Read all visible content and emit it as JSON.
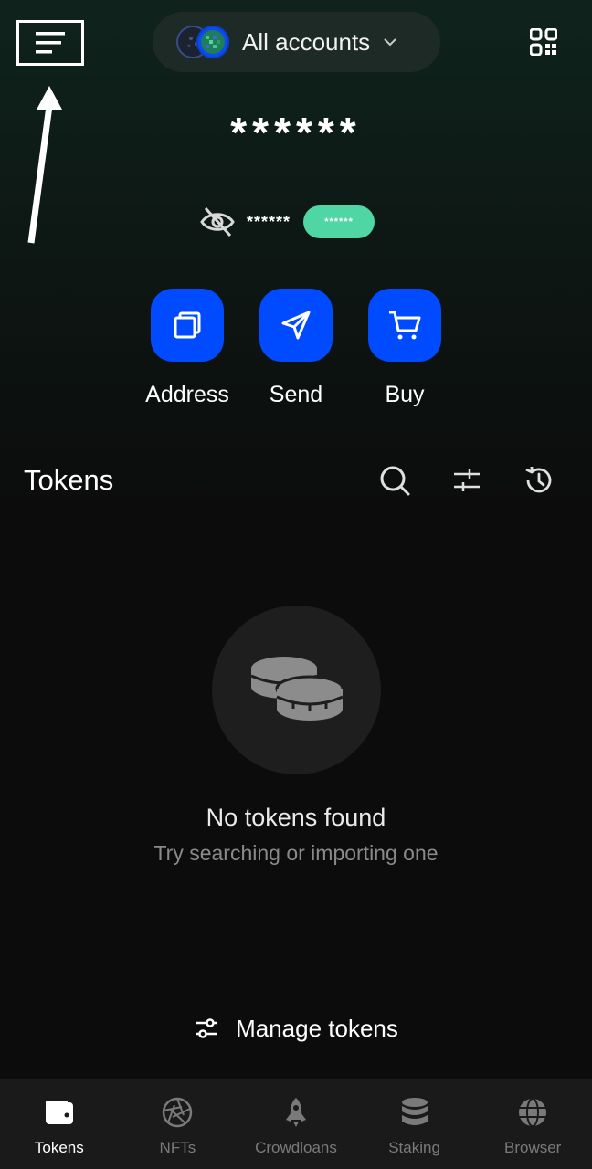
{
  "header": {
    "account_name": "All accounts"
  },
  "balance": {
    "main": "******",
    "sub_value": "******",
    "badge": "******"
  },
  "actions": [
    {
      "label": "Address"
    },
    {
      "label": "Send"
    },
    {
      "label": "Buy"
    }
  ],
  "tokens": {
    "title": "Tokens",
    "empty_title": "No tokens found",
    "empty_subtitle": "Try searching or importing one",
    "manage_label": "Manage tokens"
  },
  "tabbar": {
    "active": "Tokens",
    "items": [
      {
        "label": "Tokens",
        "icon": "wallet-icon"
      },
      {
        "label": "NFTs",
        "icon": "aperture-icon"
      },
      {
        "label": "Crowdloans",
        "icon": "rocket-icon"
      },
      {
        "label": "Staking",
        "icon": "database-icon"
      },
      {
        "label": "Browser",
        "icon": "globe-icon"
      }
    ]
  },
  "colors": {
    "accent_blue": "#004bff",
    "badge_green": "#4fd6a4"
  }
}
